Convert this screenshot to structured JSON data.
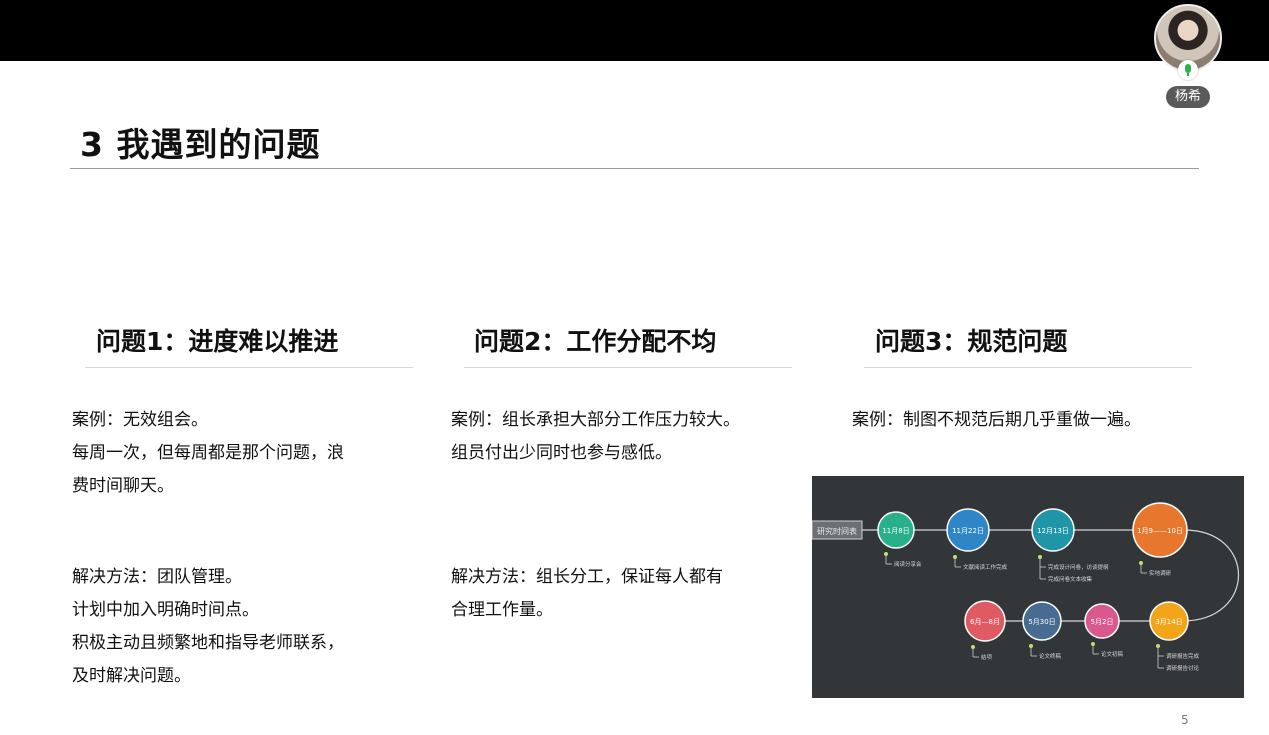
{
  "presenter": {
    "name": "杨希"
  },
  "slide": {
    "title": "3 我遇到的问题",
    "page_number": "5",
    "columns": [
      {
        "heading": "问题1：进度难以推进",
        "case_lines": [
          "案例：无效组会。",
          "每周一次，但每周都是那个问题，浪",
          "费时间聊天。"
        ],
        "solution_lines": [
          "解决方法：团队管理。",
          "计划中加入明确时间点。",
          "积极主动且频繁地和指导老师联系，",
          "及时解决问题。"
        ]
      },
      {
        "heading": "问题2：工作分配不均",
        "case_lines": [
          "案例：组长承担大部分工作压力较大。",
          "组员付出少同时也参与感低。"
        ],
        "solution_lines": [
          "解决方法：组长分工，保证每人都有",
          "合理工作量。"
        ]
      },
      {
        "heading": "问题3：规范问题",
        "case_lines": [
          "案例：制图不规范后期几乎重做一遍。"
        ]
      }
    ],
    "timeline": {
      "start_label": "研究时间表",
      "nodes": [
        {
          "label": "11月8日",
          "color": "#27b08a",
          "note": "阅读分享会"
        },
        {
          "label": "11月22日",
          "color": "#2e86c9",
          "note": "文献阅读工作完成"
        },
        {
          "label": "12月13日",
          "color": "#1f95a8",
          "note": "完成设计问卷，访谈提纲",
          "note2": "完成问卷文本收集"
        },
        {
          "label": "1月9——10日",
          "color": "#e8772e",
          "note": "实地调研"
        },
        {
          "label": "3月14日",
          "color": "#f2a518",
          "note": "调研报告完成",
          "note2": "调研报告讨论"
        },
        {
          "label": "5月2日",
          "color": "#d9588d",
          "note": "论文初稿"
        },
        {
          "label": "5月30日",
          "color": "#486b92",
          "note": "论文终稿"
        },
        {
          "label": "6月—8月",
          "color": "#e05a63",
          "note": "结项"
        }
      ]
    }
  }
}
